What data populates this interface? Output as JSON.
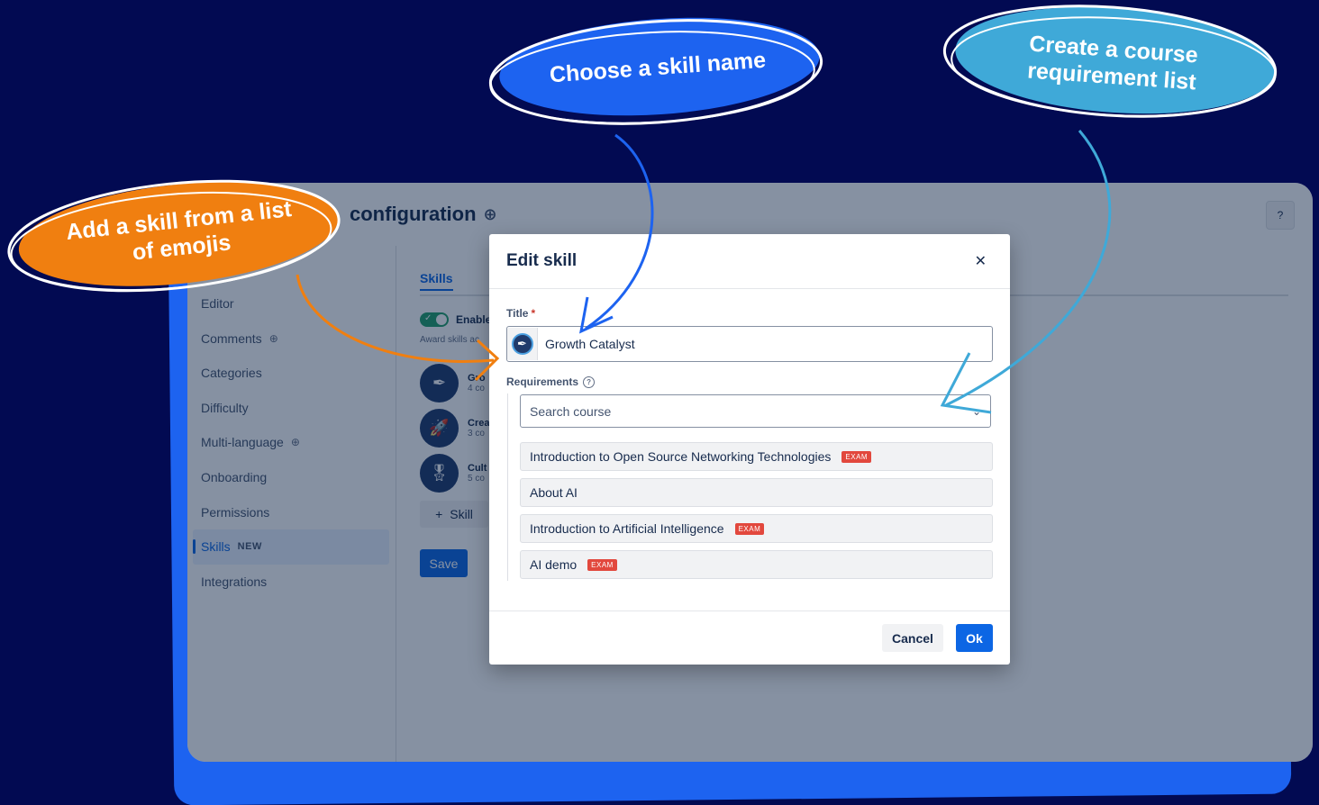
{
  "page": {
    "title": "configuration",
    "help": "?"
  },
  "sidebar": {
    "items": [
      {
        "label": "Editor"
      },
      {
        "label": "Comments"
      },
      {
        "label": "Categories"
      },
      {
        "label": "Difficulty"
      },
      {
        "label": "Multi-language"
      },
      {
        "label": "Onboarding"
      },
      {
        "label": "Permissions"
      },
      {
        "label": "Skills",
        "badge": "NEW"
      },
      {
        "label": "Integrations"
      }
    ]
  },
  "main": {
    "tab": "Skills",
    "toggle_label": "Enable",
    "award_text": "Award skills ac",
    "skills": [
      {
        "name": "Gro",
        "count": "4 co",
        "icon": "fountain-pen-icon"
      },
      {
        "name": "Crea",
        "count": "3 co",
        "icon": "rocket-icon"
      },
      {
        "name": "Cult",
        "count": "5 co",
        "icon": "medal-icon"
      }
    ],
    "add_skill": "Skill",
    "save": "Save"
  },
  "modal": {
    "title": "Edit skill",
    "title_label": "Title",
    "title_value": "Growth Catalyst",
    "requirements_label": "Requirements",
    "search_placeholder": "Search course",
    "courses": [
      {
        "name": "Introduction to Open Source Networking Technologies",
        "tag": "EXAM"
      },
      {
        "name": "About AI",
        "tag": ""
      },
      {
        "name": "Introduction to Artificial Intelligence",
        "tag": "EXAM"
      },
      {
        "name": "AI demo",
        "tag": "EXAM"
      }
    ],
    "cancel": "Cancel",
    "ok": "Ok"
  },
  "callouts": {
    "skill_name": "Choose a skill name",
    "course_list_1": "Create a course",
    "course_list_2": "requirement list",
    "emoji_1": "Add a skill from a list",
    "emoji_2": "of emojis"
  },
  "colors": {
    "background": "#020a52",
    "accent_blue": "#0c66e4",
    "callout_blue": "#1d63f0",
    "callout_cyan": "#3fa9d8",
    "callout_orange": "#f07f10"
  }
}
